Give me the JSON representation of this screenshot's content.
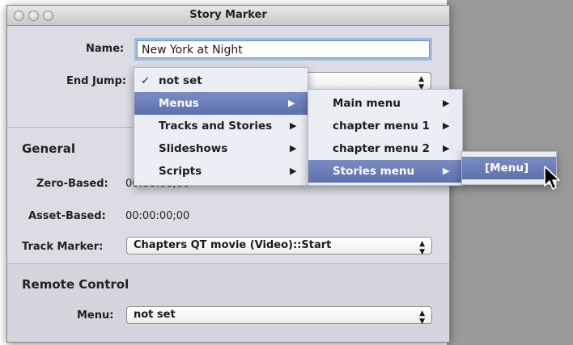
{
  "window": {
    "title": "Story Marker"
  },
  "form": {
    "name_label": "Name:",
    "name_value": "New York at Night",
    "end_jump_label": "End Jump:",
    "general_heading": "General",
    "zero_based_label": "Zero-Based:",
    "zero_based_value": "00:00:00;00",
    "asset_based_label": "Asset-Based:",
    "asset_based_value": "00:00:00;00",
    "track_marker_label": "Track Marker:",
    "track_marker_value": "Chapters QT movie (Video)::Start",
    "remote_heading": "Remote Control",
    "menu_label": "Menu:",
    "menu_value": "not set"
  },
  "menu1": {
    "items": [
      {
        "label": "not set",
        "checked": true
      },
      {
        "label": "Menus",
        "selected": true
      },
      {
        "label": "Tracks and Stories"
      },
      {
        "label": "Slideshows"
      },
      {
        "label": "Scripts"
      }
    ],
    "check_glyph": "✓",
    "arrow_glyph": "▶"
  },
  "menu2": {
    "items": [
      {
        "label": "Main menu"
      },
      {
        "label": "chapter menu 1"
      },
      {
        "label": "chapter menu 2"
      },
      {
        "label": "Stories menu",
        "selected": true
      }
    ]
  },
  "menu3": {
    "items": [
      {
        "label": "[Menu]",
        "selected": true
      }
    ]
  },
  "icons": [
    "close-button-icon",
    "minimize-button-icon",
    "zoom-button-icon",
    "popup-arrows-icon",
    "submenu-arrow-icon",
    "checkmark-icon",
    "mouse-pointer-icon"
  ],
  "colors": {
    "selection": "#6577b4",
    "window_bg": "#dcdde4",
    "desktop": "#9a9a9a"
  }
}
